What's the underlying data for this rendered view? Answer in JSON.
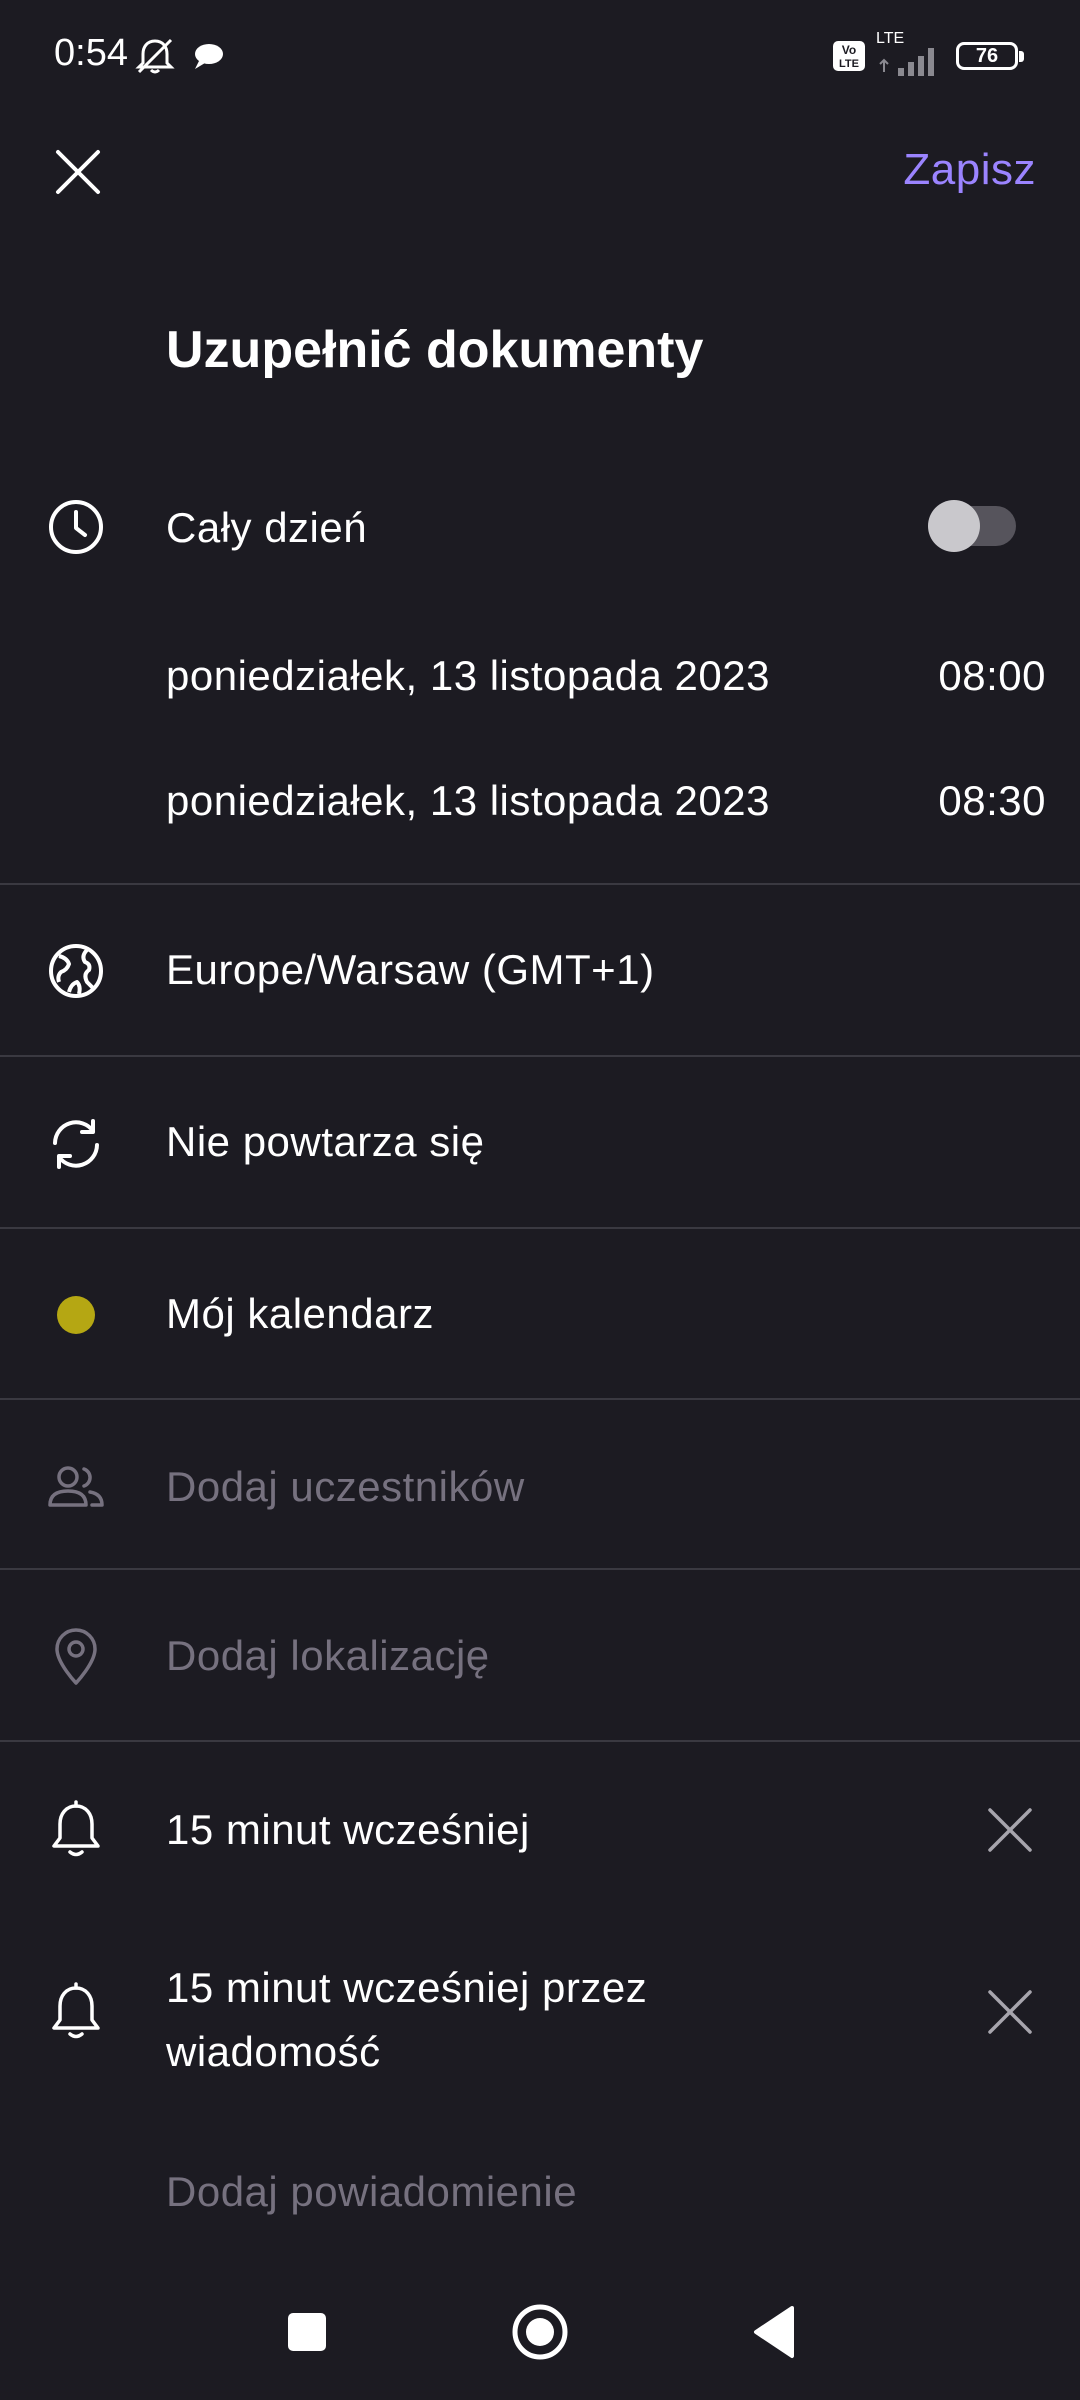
{
  "status_bar": {
    "time": "0:54",
    "network": "LTE",
    "battery": "76"
  },
  "header": {
    "save_label": "Zapisz"
  },
  "event": {
    "title": "Uzupełnić dokumenty",
    "all_day_label": "Cały dzień",
    "all_day_enabled": false,
    "start_date": "poniedziałek, 13 listopada 2023",
    "start_time": "08:00",
    "end_date": "poniedziałek, 13 listopada 2023",
    "end_time": "08:30",
    "timezone": "Europe/Warsaw (GMT+1)",
    "repeat": "Nie powtarza się",
    "calendar": "Mój kalendarz",
    "calendar_color": "#b5a713",
    "add_attendees_placeholder": "Dodaj uczestników",
    "add_location_placeholder": "Dodaj lokalizację",
    "notifications": [
      {
        "line1": "15 minut wcześniej",
        "line2": ""
      },
      {
        "line1": "15 minut wcześniej przez",
        "line2": "wiadomość"
      }
    ],
    "add_notification_label": "Dodaj powiadomienie"
  },
  "colors": {
    "background": "#1c1b22",
    "accent": "#9b84ff",
    "divider": "#3a3941",
    "placeholder_text": "#76717f"
  }
}
